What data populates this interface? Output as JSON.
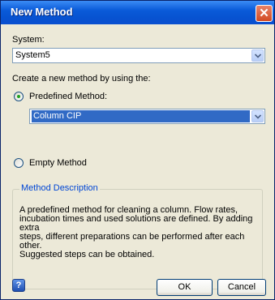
{
  "window": {
    "title": "New Method"
  },
  "system": {
    "label": "System:",
    "value": "System5"
  },
  "create_label": "Create a new method by using the:",
  "predefined": {
    "label": "Predefined Method:",
    "value": "Column CIP",
    "selected": true
  },
  "empty": {
    "label": "Empty Method",
    "selected": false
  },
  "description": {
    "title": "Method Description",
    "lines": [
      "A predefined method for cleaning a column. Flow rates,",
      "incubation times and used solutions are defined. By adding extra",
      "steps, different preparations can be performed after each other.",
      "Suggested steps can be obtained."
    ]
  },
  "buttons": {
    "ok": "OK",
    "cancel": "Cancel",
    "help": "?",
    "close": "✕"
  },
  "colors": {
    "title_bar": "#0753d1",
    "selection": "#316ac5",
    "group_title": "#0046d5"
  }
}
